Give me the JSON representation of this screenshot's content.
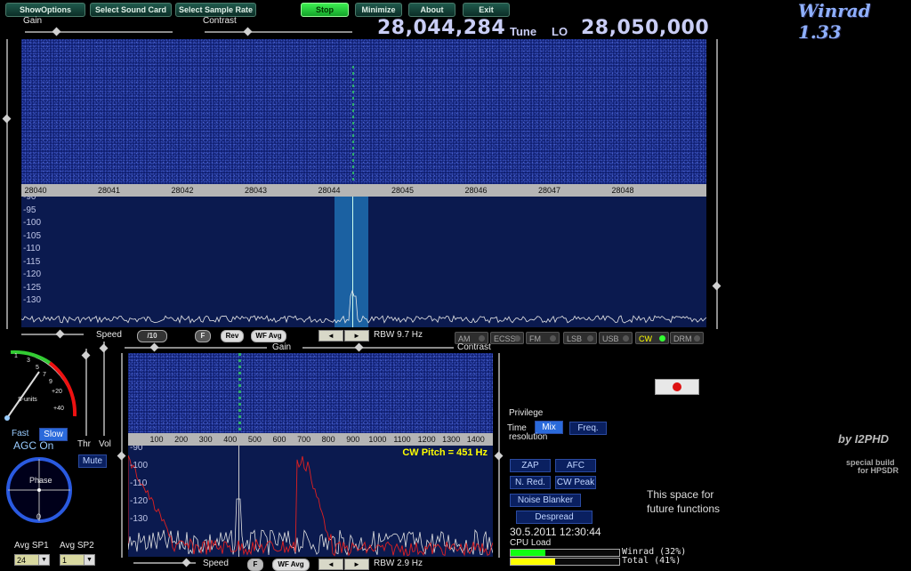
{
  "toolbar": {
    "show_options": "ShowOptions",
    "select_sound_card": "Select Sound Card",
    "select_sample_rate": "Select Sample Rate",
    "stop": "Stop",
    "minimize": "Minimize",
    "about": "About",
    "exit": "Exit"
  },
  "app_title": "Winrad 1.33",
  "labels": {
    "gain": "Gain",
    "contrast": "Contrast",
    "tune": "Tune",
    "lo": "LO",
    "speed": "Speed",
    "speed_div": "/10",
    "rbw_top": "RBW  9.7 Hz",
    "rbw_bottom": "RBW  2.9 Hz",
    "gain2": "Gain",
    "contrast2": "Contrast",
    "speed2": "Speed",
    "f": "F",
    "rev": "Rev",
    "wf_avg": "WF Avg",
    "wf_avg2": "WF Avg",
    "f2": "F",
    "thr": "Thr",
    "vol": "Vol",
    "mute": "Mute",
    "fast": "Fast",
    "slow": "Slow",
    "agc": "AGC On",
    "phase": "Phase",
    "phase_zero": "0",
    "avg_sp1": "Avg SP1",
    "avg_sp2": "Avg SP2",
    "avg_sp1_value": "24",
    "avg_sp2_value": "1",
    "cw_pitch": "CW Pitch = 451 Hz",
    "by": "by I2PHD",
    "special_build_1": "special build",
    "special_build_2": "for HPSDR",
    "privilege": "Privilege",
    "time": "Time",
    "mix": "Mix",
    "freq": "Freq.",
    "resolution": "resolution",
    "zap": "ZAP",
    "afc": "AFC",
    "nred": "N. Red.",
    "cwpeak": "CW Peak",
    "noise_blanker": "Noise Blanker",
    "despread": "Despread",
    "datetime": "30.5.2011 12:30:44",
    "cpu_load": "CPU Load",
    "cpu_winrad": "Winrad  (32%)",
    "cpu_total": "Total   (41%)",
    "future1": "This space for",
    "future2": "future functions",
    "smeter_units": "S-units"
  },
  "frequency": {
    "tune": "28,044,284",
    "lo": "28,050,000"
  },
  "cpu": {
    "winrad": 32,
    "total": 41
  },
  "modes": [
    {
      "label": "AM",
      "on": false
    },
    {
      "label": "ECSS",
      "on": false
    },
    {
      "label": "FM",
      "on": false
    },
    {
      "label": "LSB",
      "on": false
    },
    {
      "label": "USB",
      "on": false
    },
    {
      "label": "CW",
      "on": true
    },
    {
      "label": "DRM",
      "on": false
    }
  ],
  "top_scale_ticks": [
    "28040",
    "28041",
    "28042",
    "28043",
    "28044",
    "28045",
    "28046",
    "28047",
    "28048"
  ],
  "top_y_labels": [
    "-90",
    "-95",
    "-100",
    "-105",
    "-110",
    "-115",
    "-120",
    "-125",
    "-130"
  ],
  "bottom_scale_ticks": [
    "100",
    "200",
    "300",
    "400",
    "500",
    "600",
    "700",
    "800",
    "900",
    "1000",
    "1100",
    "1200",
    "1300",
    "1400"
  ],
  "bottom_y_labels": [
    "-90",
    "-100",
    "-110",
    "-120",
    "-130"
  ],
  "smeter_ticks": [
    "1",
    "3",
    "5",
    "7",
    "9",
    "+20",
    "+40"
  ],
  "nav": {
    "left": "◄",
    "right": "►"
  }
}
